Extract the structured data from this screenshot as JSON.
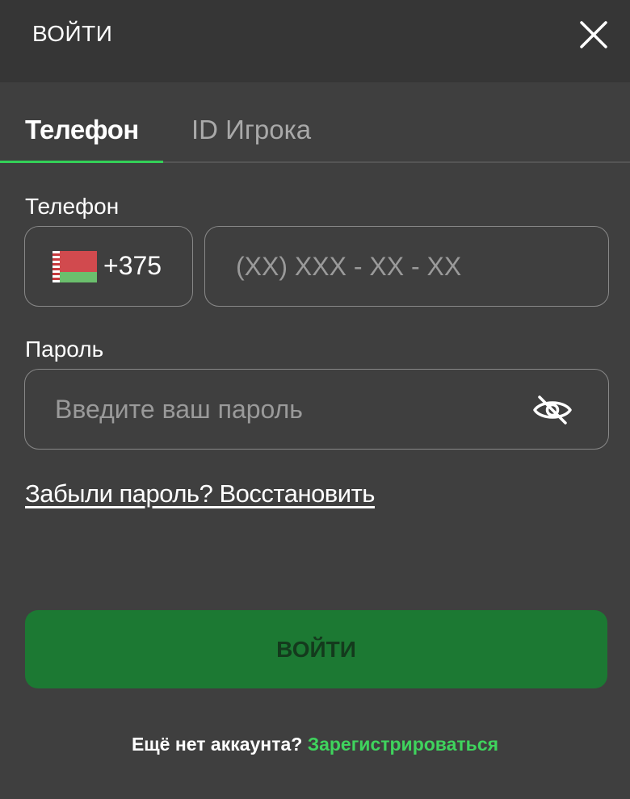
{
  "header": {
    "title": "ВОЙТИ",
    "close_icon": "close-icon"
  },
  "tabs": [
    {
      "label": "Телефон",
      "active": true
    },
    {
      "label": "ID Игрока",
      "active": false
    }
  ],
  "phone": {
    "label": "Телефон",
    "country_flag": "belarus-flag-icon",
    "country_code": "+375",
    "value": "",
    "placeholder": "(XX) XXX - XX - XX"
  },
  "password": {
    "label": "Пароль",
    "value": "",
    "placeholder": "Введите ваш пароль",
    "toggle_icon": "eye-slash-icon"
  },
  "forgot_link": "Забыли пароль? Восстановить",
  "submit_label": "ВОЙТИ",
  "footer": {
    "text": "Ещё нет аккаунта?",
    "register_link": "Зарегистрироваться"
  },
  "colors": {
    "background": "#3f3f3f",
    "header_background": "#363636",
    "accent": "#34d058",
    "button": "#1c7933",
    "button_text": "#143a1d",
    "link_green": "#3fd35d"
  }
}
